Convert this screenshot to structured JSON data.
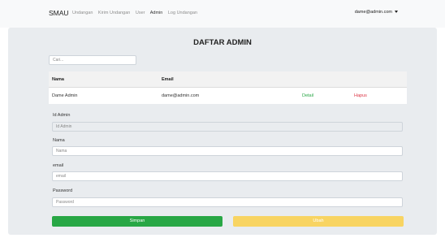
{
  "navbar": {
    "brand": "SMAU",
    "links": [
      "Undangan",
      "Kirim Undangan",
      "User",
      "Admin",
      "Log Undangan"
    ],
    "user_email": "dame@admin.com"
  },
  "page": {
    "title": "DAFTAR ADMIN"
  },
  "search": {
    "placeholder": "Cari..."
  },
  "table": {
    "headers": [
      "Nama",
      "Email",
      "",
      ""
    ],
    "rows": [
      {
        "nama": "Dame Admin",
        "email": "dame@admin.com",
        "detail": "Detail",
        "hapus": "Hapus"
      }
    ]
  },
  "form": {
    "id_label": "Id Admin",
    "id_placeholder": "Id Admin",
    "nama_label": "Nama",
    "nama_placeholder": "Nama",
    "email_label": "email",
    "email_placeholder": "email",
    "password_label": "Password",
    "password_placeholder": "Password",
    "save_label": "Simpan",
    "edit_label": "Ubah"
  },
  "colors": {
    "save": "#28a745",
    "edit": "#f8d462",
    "detail": "#28a745",
    "delete": "#dc3545"
  }
}
